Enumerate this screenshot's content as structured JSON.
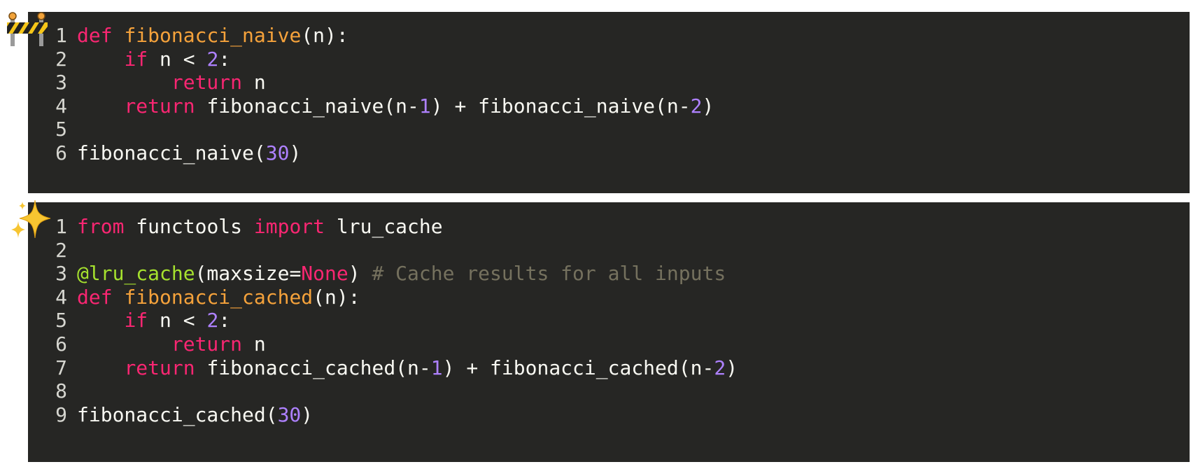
{
  "blocks": [
    {
      "badge_icon": "construction-barrier-icon",
      "lines": [
        [
          [
            "kw",
            "def "
          ],
          [
            "fn",
            "fibonacci_naive"
          ],
          [
            "tx",
            "(n):"
          ]
        ],
        [
          [
            "tx",
            "    "
          ],
          [
            "kw",
            "if"
          ],
          [
            "tx",
            " n < "
          ],
          [
            "num",
            "2"
          ],
          [
            "tx",
            ":"
          ]
        ],
        [
          [
            "tx",
            "        "
          ],
          [
            "kw",
            "return"
          ],
          [
            "tx",
            " n"
          ]
        ],
        [
          [
            "tx",
            "    "
          ],
          [
            "kw",
            "return"
          ],
          [
            "tx",
            " fibonacci_naive(n-"
          ],
          [
            "num",
            "1"
          ],
          [
            "tx",
            ") + fibonacci_naive(n-"
          ],
          [
            "num",
            "2"
          ],
          [
            "tx",
            ")"
          ]
        ],
        [],
        [
          [
            "tx",
            "fibonacci_naive("
          ],
          [
            "num",
            "30"
          ],
          [
            "tx",
            ")"
          ]
        ]
      ]
    },
    {
      "badge_icon": "sparkles-icon",
      "lines": [
        [
          [
            "kw",
            "from"
          ],
          [
            "tx",
            " functools "
          ],
          [
            "kw",
            "import"
          ],
          [
            "tx",
            " lru_cache"
          ]
        ],
        [],
        [
          [
            "dec",
            "@lru_cache"
          ],
          [
            "tx",
            "(maxsize="
          ],
          [
            "kw",
            "None"
          ],
          [
            "tx",
            ") "
          ],
          [
            "cm",
            "# Cache results for all inputs"
          ]
        ],
        [
          [
            "kw",
            "def "
          ],
          [
            "fn",
            "fibonacci_cached"
          ],
          [
            "tx",
            "(n):"
          ]
        ],
        [
          [
            "tx",
            "    "
          ],
          [
            "kw",
            "if"
          ],
          [
            "tx",
            " n < "
          ],
          [
            "num",
            "2"
          ],
          [
            "tx",
            ":"
          ]
        ],
        [
          [
            "tx",
            "        "
          ],
          [
            "kw",
            "return"
          ],
          [
            "tx",
            " n"
          ]
        ],
        [
          [
            "tx",
            "    "
          ],
          [
            "kw",
            "return"
          ],
          [
            "tx",
            " fibonacci_cached(n-"
          ],
          [
            "num",
            "1"
          ],
          [
            "tx",
            ") + fibonacci_cached(n-"
          ],
          [
            "num",
            "2"
          ],
          [
            "tx",
            ")"
          ]
        ],
        [],
        [
          [
            "tx",
            "fibonacci_cached("
          ],
          [
            "num",
            "30"
          ],
          [
            "tx",
            ")"
          ]
        ]
      ]
    }
  ],
  "colors": {
    "code_background": "#262624",
    "keyword": "#f92672",
    "function_name": "#f5a23b",
    "number": "#ae81ff",
    "decorator": "#a6e22e",
    "comment": "#75715e",
    "text": "#f8f8f2"
  }
}
